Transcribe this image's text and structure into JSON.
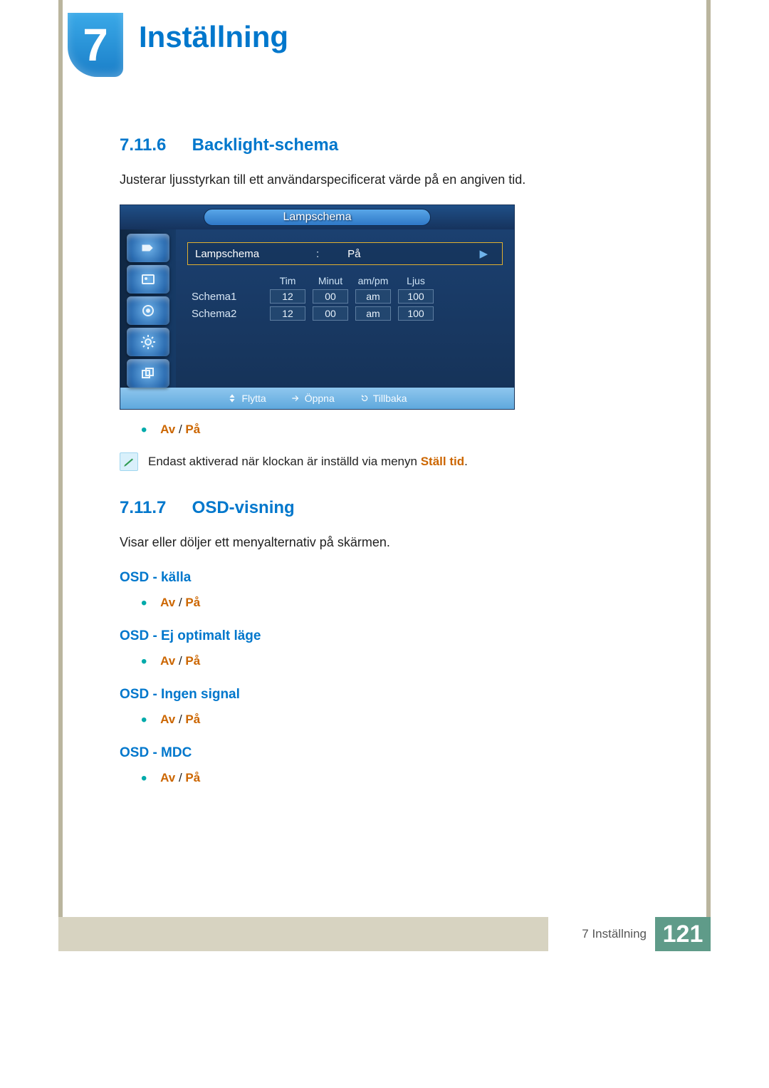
{
  "chapter": {
    "number": "7",
    "title": "Inställning"
  },
  "section1": {
    "num": "7.11.6",
    "title": "Backlight-schema",
    "body": "Justerar ljusstyrkan till ett användarspecificerat värde på en angiven tid."
  },
  "osd": {
    "title": "Lampschema",
    "row_label": "Lampschema",
    "row_value_prefix": ":",
    "row_value": "På",
    "headers": {
      "tim": "Tim",
      "minut": "Minut",
      "ampm": "am/pm",
      "ljus": "Ljus"
    },
    "rows": [
      {
        "label": "Schema1",
        "tim": "12",
        "minut": "00",
        "ampm": "am",
        "ljus": "100"
      },
      {
        "label": "Schema2",
        "tim": "12",
        "minut": "00",
        "ampm": "am",
        "ljus": "100"
      }
    ],
    "footer": {
      "move": "Flytta",
      "open": "Öppna",
      "back": "Tillbaka"
    }
  },
  "options": {
    "off": "Av",
    "sep": " / ",
    "on": "På"
  },
  "note": {
    "pre": "Endast aktiverad när klockan är inställd via menyn ",
    "link": "Ställ tid",
    "post": "."
  },
  "section2": {
    "num": "7.11.7",
    "title": "OSD-visning",
    "body": "Visar eller döljer ett menyalternativ på skärmen.",
    "subs": [
      "OSD - källa",
      "OSD - Ej optimalt läge",
      "OSD - Ingen signal",
      "OSD - MDC"
    ]
  },
  "footer": {
    "label": "7 Inställning",
    "page": "121"
  }
}
